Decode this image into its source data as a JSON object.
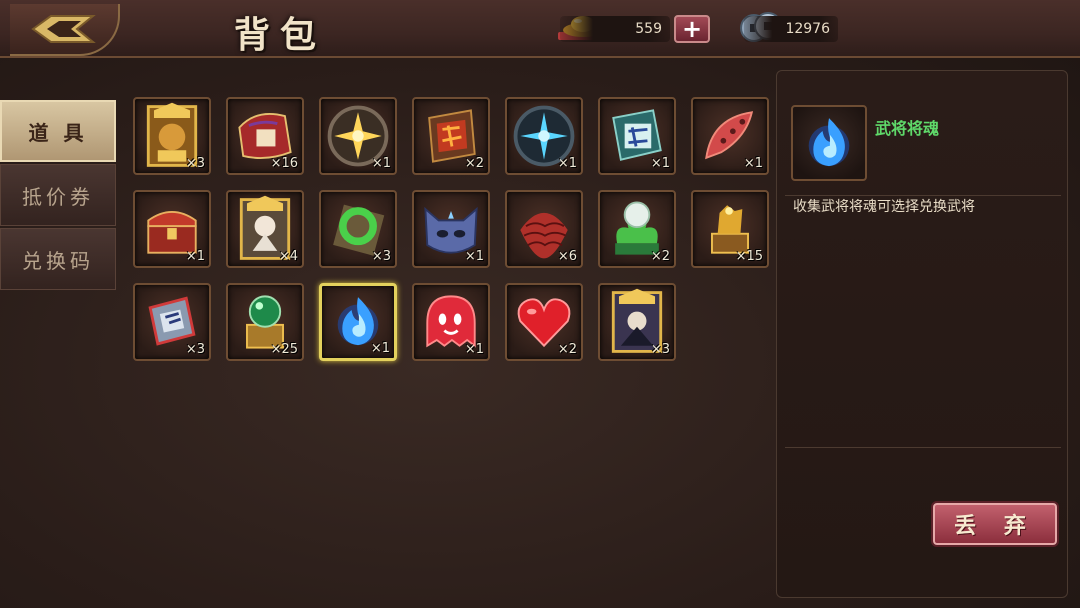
{
  "header": {
    "title": "背包",
    "gold_value": "559",
    "silver_value": "12976",
    "plus_label": "+"
  },
  "tabs": [
    {
      "label": "道 具",
      "active": true
    },
    {
      "label": "抵价券",
      "active": false
    },
    {
      "label": "兑换码",
      "active": false
    }
  ],
  "items": [
    {
      "icon": "golden-general-card-icon",
      "count": "×3"
    },
    {
      "icon": "red-scroll-icon",
      "count": "×16"
    },
    {
      "icon": "golden-spark-medallion-icon",
      "count": "×1"
    },
    {
      "icon": "red-talisman-icon",
      "count": "×2"
    },
    {
      "icon": "blue-spark-medallion-icon",
      "count": "×1"
    },
    {
      "icon": "blue-token-icon",
      "count": "×1"
    },
    {
      "icon": "red-feather-icon",
      "count": "×1"
    },
    {
      "icon": "red-treasure-chest-icon",
      "count": "×1"
    },
    {
      "icon": "white-general-card-icon",
      "count": "×4"
    },
    {
      "icon": "jade-ring-icon",
      "count": "×3"
    },
    {
      "icon": "blue-cat-mask-icon",
      "count": "×1"
    },
    {
      "icon": "red-scale-armor-icon",
      "count": "×6"
    },
    {
      "icon": "jade-pearl-dragon-icon",
      "count": "×2"
    },
    {
      "icon": "golden-qilin-seal-icon",
      "count": "×15"
    },
    {
      "icon": "blue-badge-icon",
      "count": "×3"
    },
    {
      "icon": "green-orb-seal-icon",
      "count": "×25"
    },
    {
      "icon": "blue-soul-flame-icon",
      "count": "×1",
      "selected": true
    },
    {
      "icon": "red-ghost-icon",
      "count": "×1"
    },
    {
      "icon": "red-heart-icon",
      "count": "×2"
    },
    {
      "icon": "dark-general-card-icon",
      "count": "×3"
    }
  ],
  "detail": {
    "name": "武将将魂",
    "description": "收集武将将魂可选择兑换武将",
    "discard_label": "丢 弃"
  },
  "colors": {
    "item_name": "#5fd96a",
    "selected_border": "#e3d15d",
    "discard_button": "#b24f5c"
  }
}
